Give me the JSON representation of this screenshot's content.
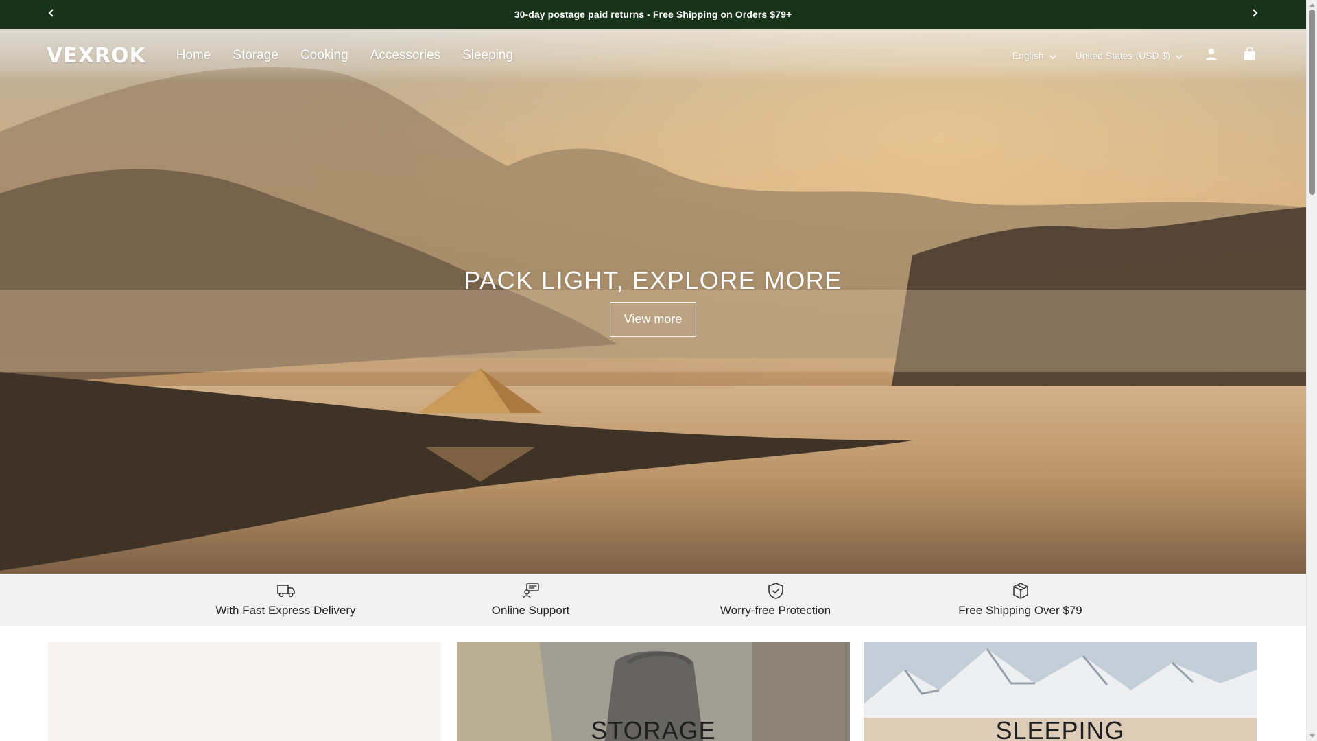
{
  "announcement": {
    "text": "30-day postage paid returns - Free Shipping on Orders $79+",
    "prev_icon": "chevron-left-icon",
    "next_icon": "chevron-right-icon"
  },
  "header": {
    "logo": "VEXROK",
    "nav": [
      {
        "label": "Home"
      },
      {
        "label": "Storage"
      },
      {
        "label": "Cooking"
      },
      {
        "label": "Accessories"
      },
      {
        "label": "Sleeping"
      }
    ],
    "language": "English",
    "currency": "United States (USD $)",
    "account_icon": "user-icon",
    "cart_icon": "shopping-bag-icon"
  },
  "hero": {
    "title": "PACK LIGHT, EXPLORE MORE",
    "cta": "View more"
  },
  "features": [
    {
      "icon": "delivery-truck-icon",
      "label": "With Fast Express Delivery"
    },
    {
      "icon": "support-chat-icon",
      "label": "Online Support"
    },
    {
      "icon": "shield-check-icon",
      "label": "Worry-free Protection"
    },
    {
      "icon": "package-box-icon",
      "label": "Free Shipping Over $79"
    }
  ],
  "collections": [
    {
      "title": ""
    },
    {
      "title": "STORAGE"
    },
    {
      "title": "SLEEPING"
    }
  ],
  "colors": {
    "announcement_bg": "#173319",
    "features_bg": "#f2f2f2",
    "text_white": "#ffffff"
  }
}
